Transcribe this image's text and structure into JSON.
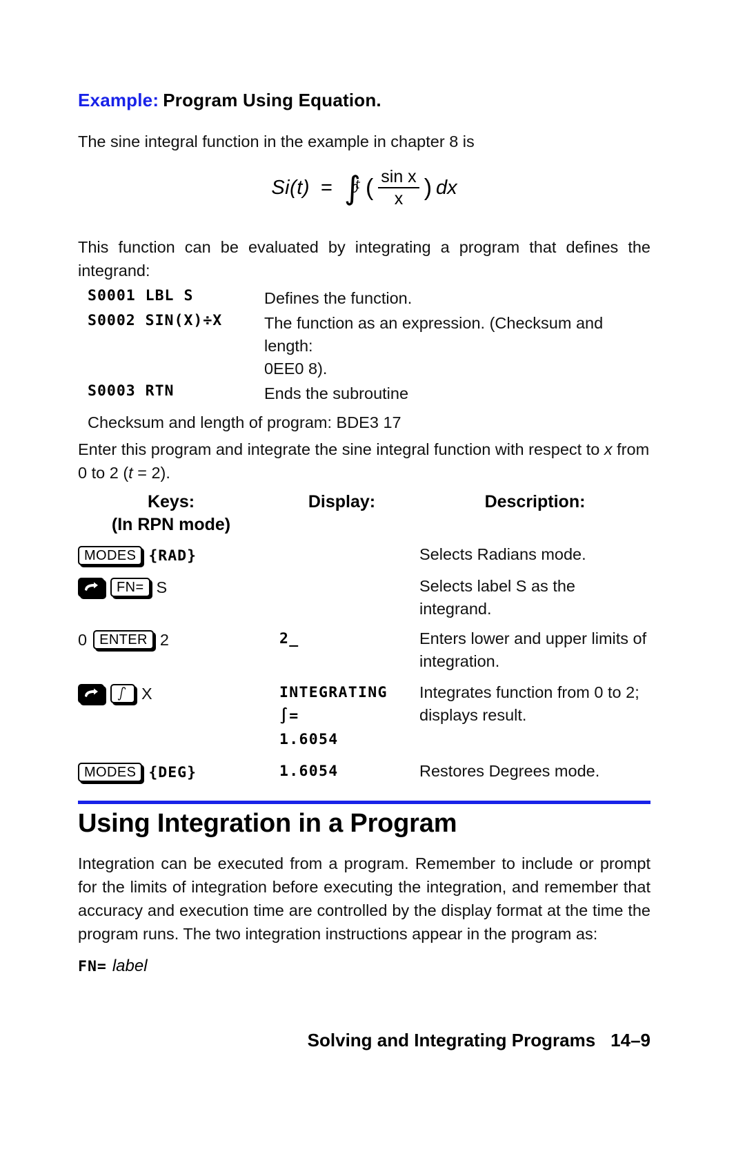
{
  "heading": {
    "keyword": "Example:",
    "rest": "Program Using Equation.",
    "keyword_color": "#1822e8"
  },
  "intro_paragraph": "The sine integral function in the example in chapter 8 is",
  "formula": {
    "lhs": "Si(t)",
    "equals": "=",
    "integral_upper": "t",
    "integral_lower": "0",
    "open_paren": "(",
    "numerator": "sin x",
    "denominator": "x",
    "close_paren": ")",
    "differential": "dx"
  },
  "this_function_paragraph": "This function can be evaluated by integrating a program that defines the integrand:",
  "program": {
    "rows": [
      {
        "code": "S0001 LBL S",
        "description": "Defines the function.",
        "description_cont": ""
      },
      {
        "code": "S0002 SIN(X)÷X",
        "description": "The function as an expression. (Checksum and length:",
        "description_cont": "0EE0   8)."
      },
      {
        "code": "S0003 RTN",
        "description": "Ends the subroutine",
        "description_cont": ""
      }
    ],
    "checksum_line": "Checksum and length of program: BDE3   17"
  },
  "enter_paragraph_parts": {
    "a": "Enter this program and integrate the sine integral function with respect to ",
    "x": "x",
    "b": " from 0 to 2 (",
    "t": "t",
    "c": " = 2)."
  },
  "keys_table": {
    "headers": {
      "keys": "Keys:",
      "keys_sub": "(In RPN mode)",
      "display": "Display:",
      "description": "Description:"
    },
    "rows": [
      {
        "keys": [
          {
            "type": "keycap",
            "label": "MODES",
            "name": "modes-key"
          },
          {
            "type": "lcd",
            "label": "{RAD}",
            "name": "rad-annunciator"
          }
        ],
        "display": "",
        "description": "Selects Radians mode."
      },
      {
        "keys": [
          {
            "type": "shift",
            "label": "",
            "name": "shift-key"
          },
          {
            "type": "keycap",
            "label": "FN=",
            "name": "fn-equals-key"
          },
          {
            "type": "plain",
            "label": "S",
            "name": "label-s"
          }
        ],
        "display": "",
        "description": "Selects label S as the integrand."
      },
      {
        "keys": [
          {
            "type": "plain",
            "label": "0",
            "name": "digit-zero"
          },
          {
            "type": "keycap",
            "label": "ENTER",
            "name": "enter-key"
          },
          {
            "type": "plain",
            "label": "2",
            "name": "digit-two"
          }
        ],
        "display": "2_",
        "description": "Enters lower and upper limits of integration."
      },
      {
        "keys": [
          {
            "type": "shift",
            "label": "",
            "name": "shift-key"
          },
          {
            "type": "integral",
            "label": "∫",
            "name": "integral-key"
          },
          {
            "type": "plain",
            "label": "X",
            "name": "variable-x"
          }
        ],
        "display": "INTEGRATING\n∫=\n1.6054",
        "description": "Integrates function from 0 to 2; displays result."
      },
      {
        "keys": [
          {
            "type": "keycap",
            "label": "MODES",
            "name": "modes-key"
          },
          {
            "type": "lcd",
            "label": "{DEG}",
            "name": "deg-annunciator"
          }
        ],
        "display": "1.6054",
        "description": "Restores Degrees mode."
      }
    ]
  },
  "section": {
    "rule_color": "#1822e8",
    "title": "Using Integration in a Program",
    "paragraph": "Integration can be executed from a program. Remember to include or prompt for the limits of integration before executing the integration, and remember that accuracy and execution time are controlled by the display format at the time the program runs. The two integration instructions appear in the program as:",
    "instruction_mono": "FN=",
    "instruction_italic": "label"
  },
  "footer": {
    "title": "Solving and Integrating Programs",
    "page": "14–9"
  }
}
